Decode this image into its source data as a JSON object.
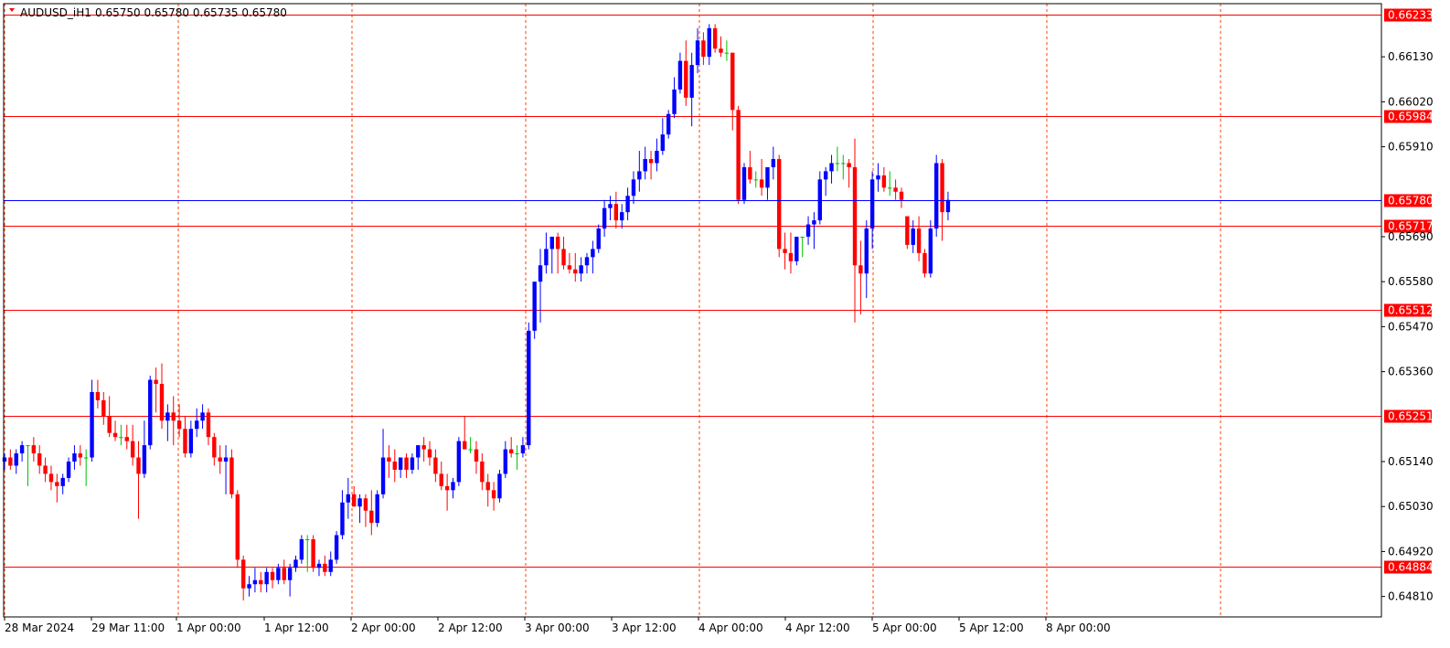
{
  "header": {
    "symbol_label": "AUDUSD_iH1",
    "ohlc": "0.65750 0.65780 0.65735 0.65780"
  },
  "colors": {
    "bull": "#0000ff",
    "bear": "#ff0000",
    "neutral": "#00c000",
    "level_line": "#ff0000",
    "price_line": "#0000ff",
    "grid": "#ff4000",
    "frame": "#000000"
  },
  "chart_data": {
    "type": "candlestick",
    "symbol": "AUDUSD_iH1",
    "timeframe": "H1",
    "ylim": [
      0.6476,
      0.6626
    ],
    "y_ticks": [
      "0.66130",
      "0.66020",
      "0.65910",
      "0.65690",
      "0.65580",
      "0.65470",
      "0.65360",
      "0.65140",
      "0.65030",
      "0.64920",
      "0.64810"
    ],
    "x_ticks": [
      "28 Mar 2024",
      "29 Mar 11:00",
      "1 Apr 00:00",
      "1 Apr 12:00",
      "2 Apr 00:00",
      "2 Apr 12:00",
      "3 Apr 00:00",
      "3 Apr 12:00",
      "4 Apr 00:00",
      "4 Apr 12:00",
      "5 Apr 00:00",
      "5 Apr 12:00",
      "8 Apr 00:00"
    ],
    "levels": [
      {
        "label": "0.66233",
        "value": 0.66233
      },
      {
        "label": "0.65984",
        "value": 0.65984
      },
      {
        "label": "0.65717",
        "value": 0.65717
      },
      {
        "label": "0.65512",
        "value": 0.65512
      },
      {
        "label": "0.65251",
        "value": 0.65251
      },
      {
        "label": "0.64884",
        "value": 0.64884
      }
    ],
    "current_price": {
      "label": "0.65780",
      "value": 0.6578
    },
    "candles": [
      [
        0.6514,
        0.6516,
        0.6512,
        0.6515
      ],
      [
        0.6515,
        0.6517,
        0.6512,
        0.6513
      ],
      [
        0.6513,
        0.6517,
        0.6511,
        0.6516
      ],
      [
        0.6516,
        0.6519,
        0.6514,
        0.6518
      ],
      [
        0.6518,
        0.6518,
        0.6508,
        0.6518
      ],
      [
        0.6518,
        0.652,
        0.6514,
        0.6516
      ],
      [
        0.6516,
        0.6518,
        0.6511,
        0.6513
      ],
      [
        0.6513,
        0.6515,
        0.6509,
        0.6511
      ],
      [
        0.6511,
        0.6513,
        0.6507,
        0.6509
      ],
      [
        0.6509,
        0.6511,
        0.6504,
        0.6508
      ],
      [
        0.6508,
        0.6511,
        0.6506,
        0.651
      ],
      [
        0.651,
        0.6515,
        0.6509,
        0.6514
      ],
      [
        0.6514,
        0.6518,
        0.6512,
        0.6516
      ],
      [
        0.6516,
        0.6518,
        0.6513,
        0.6515
      ],
      [
        0.6515,
        0.6517,
        0.6508,
        0.6515
      ],
      [
        0.6515,
        0.6534,
        0.6514,
        0.6531
      ],
      [
        0.6531,
        0.6534,
        0.6527,
        0.6529
      ],
      [
        0.6529,
        0.6531,
        0.6523,
        0.6525
      ],
      [
        0.6525,
        0.653,
        0.652,
        0.6521
      ],
      [
        0.6521,
        0.6524,
        0.6519,
        0.652
      ],
      [
        0.652,
        0.6523,
        0.6518,
        0.652
      ],
      [
        0.652,
        0.6523,
        0.6517,
        0.6519
      ],
      [
        0.6519,
        0.6523,
        0.6513,
        0.6515
      ],
      [
        0.6515,
        0.6519,
        0.65,
        0.6511
      ],
      [
        0.6511,
        0.6524,
        0.651,
        0.6518
      ],
      [
        0.6518,
        0.6535,
        0.6517,
        0.6534
      ],
      [
        0.6534,
        0.6537,
        0.6526,
        0.6533
      ],
      [
        0.6533,
        0.6538,
        0.6522,
        0.6524
      ],
      [
        0.6524,
        0.6528,
        0.6519,
        0.6526
      ],
      [
        0.6526,
        0.653,
        0.6518,
        0.6524
      ],
      [
        0.6524,
        0.6528,
        0.652,
        0.6522
      ],
      [
        0.6522,
        0.6525,
        0.6515,
        0.6516
      ],
      [
        0.6516,
        0.6524,
        0.6515,
        0.6522
      ],
      [
        0.6522,
        0.6527,
        0.652,
        0.6524
      ],
      [
        0.6524,
        0.6528,
        0.6522,
        0.6526
      ],
      [
        0.6526,
        0.6527,
        0.6518,
        0.652
      ],
      [
        0.652,
        0.6521,
        0.6513,
        0.6515
      ],
      [
        0.6515,
        0.6518,
        0.6511,
        0.6514
      ],
      [
        0.6514,
        0.6518,
        0.6506,
        0.6515
      ],
      [
        0.6515,
        0.6517,
        0.6505,
        0.6506
      ],
      [
        0.6506,
        0.6507,
        0.6488,
        0.649
      ],
      [
        0.649,
        0.6491,
        0.648,
        0.6483
      ],
      [
        0.6483,
        0.6486,
        0.6481,
        0.6484
      ],
      [
        0.6484,
        0.6488,
        0.6482,
        0.6485
      ],
      [
        0.6485,
        0.6487,
        0.6482,
        0.6484
      ],
      [
        0.6484,
        0.6488,
        0.6482,
        0.6487
      ],
      [
        0.6487,
        0.6488,
        0.6483,
        0.6485
      ],
      [
        0.6485,
        0.6489,
        0.6484,
        0.6488
      ],
      [
        0.6488,
        0.649,
        0.6484,
        0.6485
      ],
      [
        0.6485,
        0.6489,
        0.6481,
        0.6488
      ],
      [
        0.6488,
        0.6491,
        0.6487,
        0.649
      ],
      [
        0.649,
        0.6496,
        0.6489,
        0.6495
      ],
      [
        0.6495,
        0.6496,
        0.6487,
        0.6495
      ],
      [
        0.6495,
        0.6496,
        0.6487,
        0.6488
      ],
      [
        0.6488,
        0.649,
        0.6486,
        0.6489
      ],
      [
        0.6489,
        0.6491,
        0.6486,
        0.6487
      ],
      [
        0.6487,
        0.6492,
        0.6486,
        0.649
      ],
      [
        0.649,
        0.6497,
        0.6489,
        0.6496
      ],
      [
        0.6496,
        0.6507,
        0.6495,
        0.6504
      ],
      [
        0.6504,
        0.651,
        0.65,
        0.6506
      ],
      [
        0.6506,
        0.6508,
        0.6503,
        0.6503
      ],
      [
        0.6503,
        0.6506,
        0.6499,
        0.6505
      ],
      [
        0.6505,
        0.6506,
        0.6498,
        0.6502
      ],
      [
        0.6502,
        0.6507,
        0.6496,
        0.6499
      ],
      [
        0.6499,
        0.6507,
        0.6498,
        0.6506
      ],
      [
        0.6506,
        0.6522,
        0.6505,
        0.6515
      ],
      [
        0.6515,
        0.6518,
        0.651,
        0.6514
      ],
      [
        0.6514,
        0.6517,
        0.6509,
        0.6512
      ],
      [
        0.6512,
        0.6515,
        0.651,
        0.6515
      ],
      [
        0.6515,
        0.6516,
        0.651,
        0.6512
      ],
      [
        0.6512,
        0.6516,
        0.6511,
        0.6515
      ],
      [
        0.6515,
        0.6517,
        0.6512,
        0.6518
      ],
      [
        0.6518,
        0.652,
        0.6514,
        0.6517
      ],
      [
        0.6517,
        0.6519,
        0.6513,
        0.6515
      ],
      [
        0.6515,
        0.6517,
        0.6509,
        0.6511
      ],
      [
        0.6511,
        0.6514,
        0.6507,
        0.6508
      ],
      [
        0.6508,
        0.6511,
        0.6502,
        0.6507
      ],
      [
        0.6507,
        0.651,
        0.6505,
        0.6509
      ],
      [
        0.6509,
        0.652,
        0.6508,
        0.6519
      ],
      [
        0.6519,
        0.6525,
        0.6517,
        0.6517
      ],
      [
        0.6517,
        0.652,
        0.6516,
        0.6517
      ],
      [
        0.6517,
        0.6519,
        0.6511,
        0.6514
      ],
      [
        0.6514,
        0.6516,
        0.6507,
        0.6509
      ],
      [
        0.6509,
        0.6511,
        0.6503,
        0.6507
      ],
      [
        0.6507,
        0.6509,
        0.6502,
        0.6505
      ],
      [
        0.6505,
        0.6512,
        0.6504,
        0.6511
      ],
      [
        0.6511,
        0.6519,
        0.651,
        0.6517
      ],
      [
        0.6517,
        0.652,
        0.6515,
        0.6516
      ],
      [
        0.6516,
        0.6518,
        0.6512,
        0.6516
      ],
      [
        0.6516,
        0.652,
        0.6515,
        0.6518
      ],
      [
        0.6518,
        0.6548,
        0.6517,
        0.6546
      ],
      [
        0.6546,
        0.6556,
        0.6544,
        0.6558
      ],
      [
        0.6558,
        0.6566,
        0.6548,
        0.6562
      ],
      [
        0.6562,
        0.657,
        0.656,
        0.6566
      ],
      [
        0.6566,
        0.6569,
        0.656,
        0.6569
      ],
      [
        0.6569,
        0.657,
        0.656,
        0.6566
      ],
      [
        0.6566,
        0.6569,
        0.6561,
        0.6562
      ],
      [
        0.6562,
        0.6565,
        0.656,
        0.6561
      ],
      [
        0.6561,
        0.6565,
        0.6558,
        0.656
      ],
      [
        0.656,
        0.6564,
        0.6558,
        0.6562
      ],
      [
        0.6562,
        0.6565,
        0.656,
        0.6564
      ],
      [
        0.6564,
        0.6568,
        0.656,
        0.6566
      ],
      [
        0.6566,
        0.6572,
        0.6565,
        0.6571
      ],
      [
        0.6571,
        0.6578,
        0.6569,
        0.6576
      ],
      [
        0.6576,
        0.6579,
        0.6573,
        0.6577
      ],
      [
        0.6577,
        0.658,
        0.6571,
        0.6573
      ],
      [
        0.6573,
        0.6577,
        0.6571,
        0.6575
      ],
      [
        0.6575,
        0.6581,
        0.6573,
        0.6579
      ],
      [
        0.6579,
        0.6585,
        0.6577,
        0.6583
      ],
      [
        0.6583,
        0.659,
        0.658,
        0.6585
      ],
      [
        0.6585,
        0.6591,
        0.6583,
        0.6588
      ],
      [
        0.6588,
        0.659,
        0.6583,
        0.6587
      ],
      [
        0.6587,
        0.6593,
        0.6585,
        0.659
      ],
      [
        0.659,
        0.6598,
        0.6589,
        0.6594
      ],
      [
        0.6594,
        0.66,
        0.6593,
        0.6599
      ],
      [
        0.6599,
        0.6608,
        0.6598,
        0.6605
      ],
      [
        0.6605,
        0.6614,
        0.6604,
        0.6612
      ],
      [
        0.6612,
        0.6617,
        0.6601,
        0.6603
      ],
      [
        0.6603,
        0.6614,
        0.6596,
        0.6611
      ],
      [
        0.6611,
        0.662,
        0.6609,
        0.6617
      ],
      [
        0.6617,
        0.6619,
        0.6611,
        0.6613
      ],
      [
        0.6613,
        0.6621,
        0.6611,
        0.662
      ],
      [
        0.662,
        0.6621,
        0.6614,
        0.6615
      ],
      [
        0.6615,
        0.6618,
        0.6613,
        0.6614
      ],
      [
        0.6614,
        0.6617,
        0.6612,
        0.6614
      ],
      [
        0.6614,
        0.6614,
        0.6595,
        0.66
      ],
      [
        0.66,
        0.6601,
        0.6577,
        0.6578
      ],
      [
        0.6578,
        0.6587,
        0.6577,
        0.6586
      ],
      [
        0.6586,
        0.659,
        0.6582,
        0.6583
      ],
      [
        0.6583,
        0.6585,
        0.6581,
        0.6583
      ],
      [
        0.6583,
        0.6588,
        0.6579,
        0.6581
      ],
      [
        0.6581,
        0.6584,
        0.6578,
        0.6586
      ],
      [
        0.6586,
        0.6591,
        0.6583,
        0.6588
      ],
      [
        0.6588,
        0.6589,
        0.6564,
        0.6566
      ],
      [
        0.6566,
        0.657,
        0.6561,
        0.6565
      ],
      [
        0.6565,
        0.657,
        0.656,
        0.6563
      ],
      [
        0.6563,
        0.6569,
        0.6562,
        0.6569
      ],
      [
        0.6569,
        0.6569,
        0.6564,
        0.6569
      ],
      [
        0.6569,
        0.6574,
        0.6567,
        0.6572
      ],
      [
        0.6572,
        0.6575,
        0.6566,
        0.6573
      ],
      [
        0.6573,
        0.6585,
        0.6572,
        0.6583
      ],
      [
        0.6583,
        0.6586,
        0.6579,
        0.6585
      ],
      [
        0.6585,
        0.6589,
        0.6582,
        0.6587
      ],
      [
        0.6587,
        0.6591,
        0.6585,
        0.6587
      ],
      [
        0.6587,
        0.6589,
        0.6583,
        0.6587
      ],
      [
        0.6587,
        0.6588,
        0.6581,
        0.6586
      ],
      [
        0.6586,
        0.6593,
        0.6548,
        0.6562
      ],
      [
        0.6562,
        0.6568,
        0.655,
        0.656
      ],
      [
        0.656,
        0.6573,
        0.6554,
        0.6571
      ],
      [
        0.6571,
        0.6585,
        0.6566,
        0.6583
      ],
      [
        0.6583,
        0.6587,
        0.658,
        0.6584
      ],
      [
        0.6584,
        0.6586,
        0.658,
        0.6581
      ],
      [
        0.6581,
        0.6585,
        0.6579,
        0.6581
      ],
      [
        0.6581,
        0.6583,
        0.6578,
        0.658
      ],
      [
        0.658,
        0.6581,
        0.6576,
        0.6578
      ],
      [
        0.6574,
        0.6574,
        0.6566,
        0.6567
      ],
      [
        0.6567,
        0.6573,
        0.6565,
        0.6571
      ],
      [
        0.6571,
        0.6574,
        0.6563,
        0.6565
      ],
      [
        0.6565,
        0.6566,
        0.6559,
        0.656
      ],
      [
        0.656,
        0.6573,
        0.6559,
        0.6571
      ],
      [
        0.6571,
        0.6589,
        0.6569,
        0.6587
      ],
      [
        0.6587,
        0.6588,
        0.6568,
        0.6575
      ],
      [
        0.6575,
        0.658,
        0.6573,
        0.6578
      ]
    ]
  }
}
